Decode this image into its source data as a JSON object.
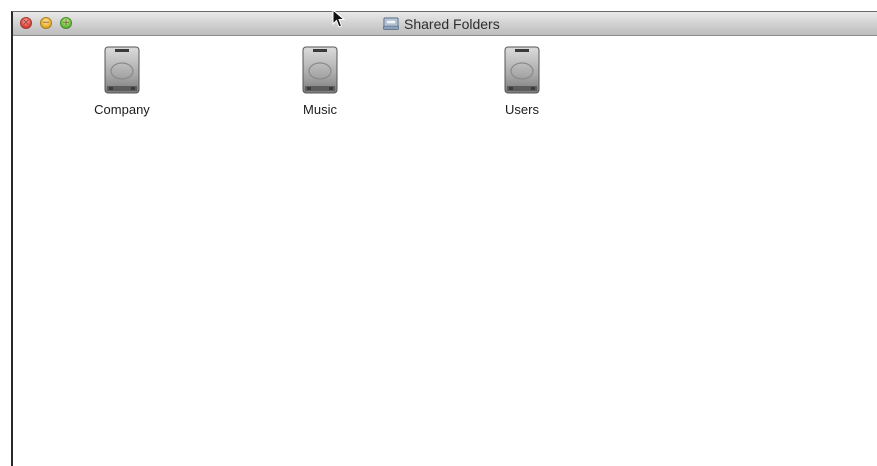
{
  "window": {
    "title": "Shared Folders",
    "title_icon": "shared-folder-icon"
  },
  "items": [
    {
      "label": "Company",
      "icon": "hard-drive-icon"
    },
    {
      "label": "Music",
      "icon": "hard-drive-icon"
    },
    {
      "label": "Users",
      "icon": "hard-drive-icon"
    }
  ],
  "colors": {
    "close": "#e0483e",
    "minimize": "#e9b12e",
    "zoom": "#6dbd3f"
  }
}
